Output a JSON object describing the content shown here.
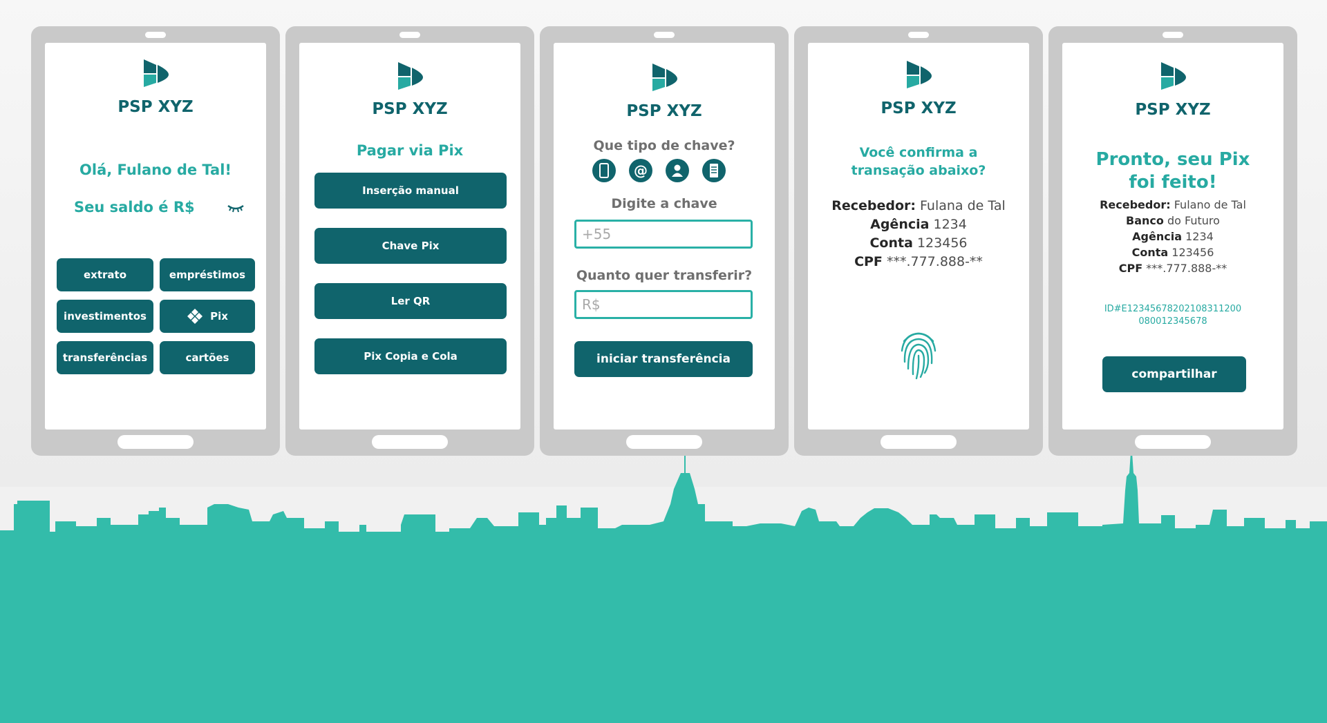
{
  "brand": "PSP XYZ",
  "colors": {
    "dark_teal": "#10646c",
    "teal": "#27aaa2",
    "skyline": "#33bcaa"
  },
  "screen1": {
    "greeting": "Olá, Fulano de Tal!",
    "balance_label": "Seu saldo é R$",
    "buttons": {
      "extrato": "extrato",
      "emprestimos": "empréstimos",
      "investimentos": "investimentos",
      "pix": "Pix",
      "transferencias": "transferências",
      "cartoes": "cartões"
    }
  },
  "screen2": {
    "title": "Pagar via Pix",
    "buttons": [
      "Inserção manual",
      "Chave Pix",
      "Ler QR",
      "Pix Copia e Cola"
    ]
  },
  "screen3": {
    "key_question": "Que tipo de chave?",
    "key_types": [
      "phone-icon",
      "at-icon",
      "person-icon",
      "document-icon"
    ],
    "key_label": "Digite a chave",
    "key_placeholder": "+55",
    "amount_label": "Quanto quer transferir?",
    "amount_placeholder": "R$",
    "submit": "iniciar transferência"
  },
  "screen4": {
    "title_line1": "Você confirma a",
    "title_line2": "transação abaixo?",
    "receiver_label": "Recebedor:",
    "receiver": "Fulana de Tal",
    "agency_label": "Agência",
    "agency": "1234",
    "account_label": "Conta",
    "account": "123456",
    "cpf_label": "CPF",
    "cpf": "***.777.888-**"
  },
  "screen5": {
    "title_line1": "Pronto, seu Pix",
    "title_line2": "foi feito!",
    "receiver_label": "Recebedor:",
    "receiver": "Fulano de Tal",
    "bank_label": "Banco",
    "bank": "do Futuro",
    "agency_label": "Agência",
    "agency": "1234",
    "account_label": "Conta",
    "account": "123456",
    "cpf_label": "CPF",
    "cpf": "***.777.888-**",
    "id_line1": "ID#E12345678202108311200",
    "id_line2": "080012345678",
    "share": "compartilhar"
  }
}
